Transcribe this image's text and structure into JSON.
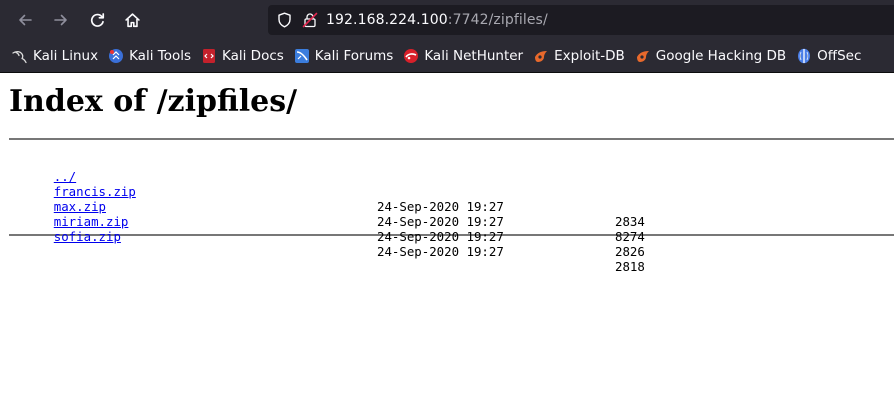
{
  "browser": {
    "url_host": "192.168.224.100",
    "url_rest": ":7742/zipfiles/",
    "bookmarks": [
      {
        "label": "Kali Linux",
        "icon": "kali-dragon-icon"
      },
      {
        "label": "Kali Tools",
        "icon": "kali-tools-icon"
      },
      {
        "label": "Kali Docs",
        "icon": "kali-docs-icon"
      },
      {
        "label": "Kali Forums",
        "icon": "kali-forums-icon"
      },
      {
        "label": "Kali NetHunter",
        "icon": "kali-nethunter-icon"
      },
      {
        "label": "Exploit-DB",
        "icon": "exploit-db-icon"
      },
      {
        "label": "Google Hacking DB",
        "icon": "ghdb-icon"
      },
      {
        "label": "OffSec",
        "icon": "offsec-icon"
      }
    ]
  },
  "page": {
    "title": "Index of /zipfiles/",
    "parent_link": "../",
    "files": [
      {
        "name": "francis.zip",
        "date": "24-Sep-2020 19:27",
        "size": "2834"
      },
      {
        "name": "max.zip",
        "date": "24-Sep-2020 19:27",
        "size": "8274"
      },
      {
        "name": "miriam.zip",
        "date": "24-Sep-2020 19:27",
        "size": "2826"
      },
      {
        "name": "sofia.zip",
        "date": "24-Sep-2020 19:27",
        "size": "2818"
      }
    ]
  },
  "colors": {
    "chrome": "#2b2a33",
    "urlbar": "#1c1b22",
    "link": "#0000ee"
  }
}
